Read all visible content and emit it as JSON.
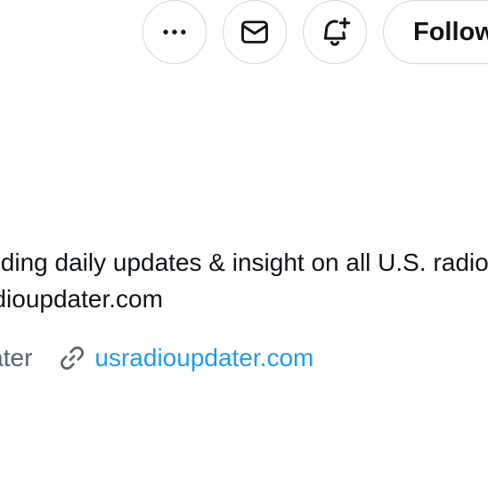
{
  "actions": {
    "more_label": "More",
    "message_label": "Message",
    "notify_label": "Turn on post notifications",
    "follow_label": "Follow"
  },
  "bio": {
    "line1": "Providing daily updates & insight on all U.S. radio",
    "line2": "usradioupdater.com"
  },
  "meta": {
    "handle_fragment": "pdater",
    "website": "usradioupdater.com"
  },
  "colors": {
    "link": "#1d9bf0",
    "border": "#cfd9de",
    "secondary_text": "#536471"
  },
  "icons": [
    "more-horizontal-icon",
    "mail-icon",
    "bell-plus-icon",
    "link-icon"
  ]
}
